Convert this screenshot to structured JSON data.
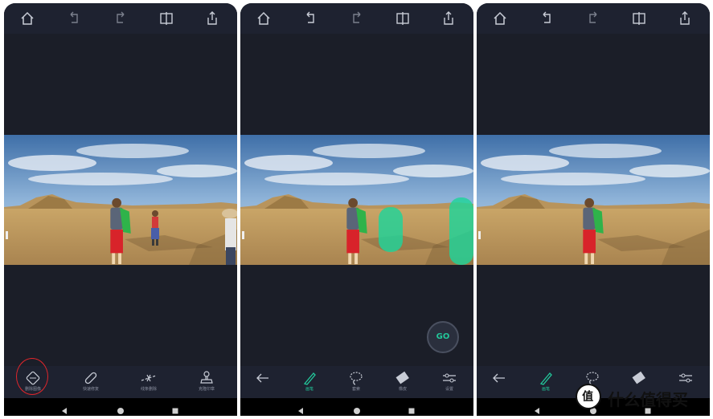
{
  "screens": [
    {
      "tools": [
        {
          "label": "删除图像",
          "icon": "hand-eraser-icon"
        },
        {
          "label": "快速修复",
          "icon": "bandage-icon"
        },
        {
          "label": "线条删除",
          "icon": "line-cut-icon"
        },
        {
          "label": "克隆印章",
          "icon": "stamp-icon"
        }
      ]
    },
    {
      "go_label": "GO",
      "tools": [
        {
          "label": "",
          "icon": "back-arrow-icon"
        },
        {
          "label": "画笔",
          "icon": "brush-icon"
        },
        {
          "label": "套索",
          "icon": "lasso-icon"
        },
        {
          "label": "橡皮",
          "icon": "eraser-icon"
        },
        {
          "label": "设置",
          "icon": "settings-sliders-icon"
        }
      ]
    },
    {
      "tools": [
        {
          "label": "",
          "icon": "back-arrow-icon"
        },
        {
          "label": "画笔",
          "icon": "brush-icon"
        },
        {
          "label": "",
          "icon": "lasso-icon"
        },
        {
          "label": "",
          "icon": "eraser-icon"
        },
        {
          "label": "",
          "icon": "settings-sliders-icon"
        }
      ]
    }
  ],
  "watermark": {
    "text": "什么值得买",
    "logo_text": "值"
  },
  "colors": {
    "accent": "#22c79a",
    "highlight_ring": "#e0262b",
    "background": "#1c1f29"
  }
}
